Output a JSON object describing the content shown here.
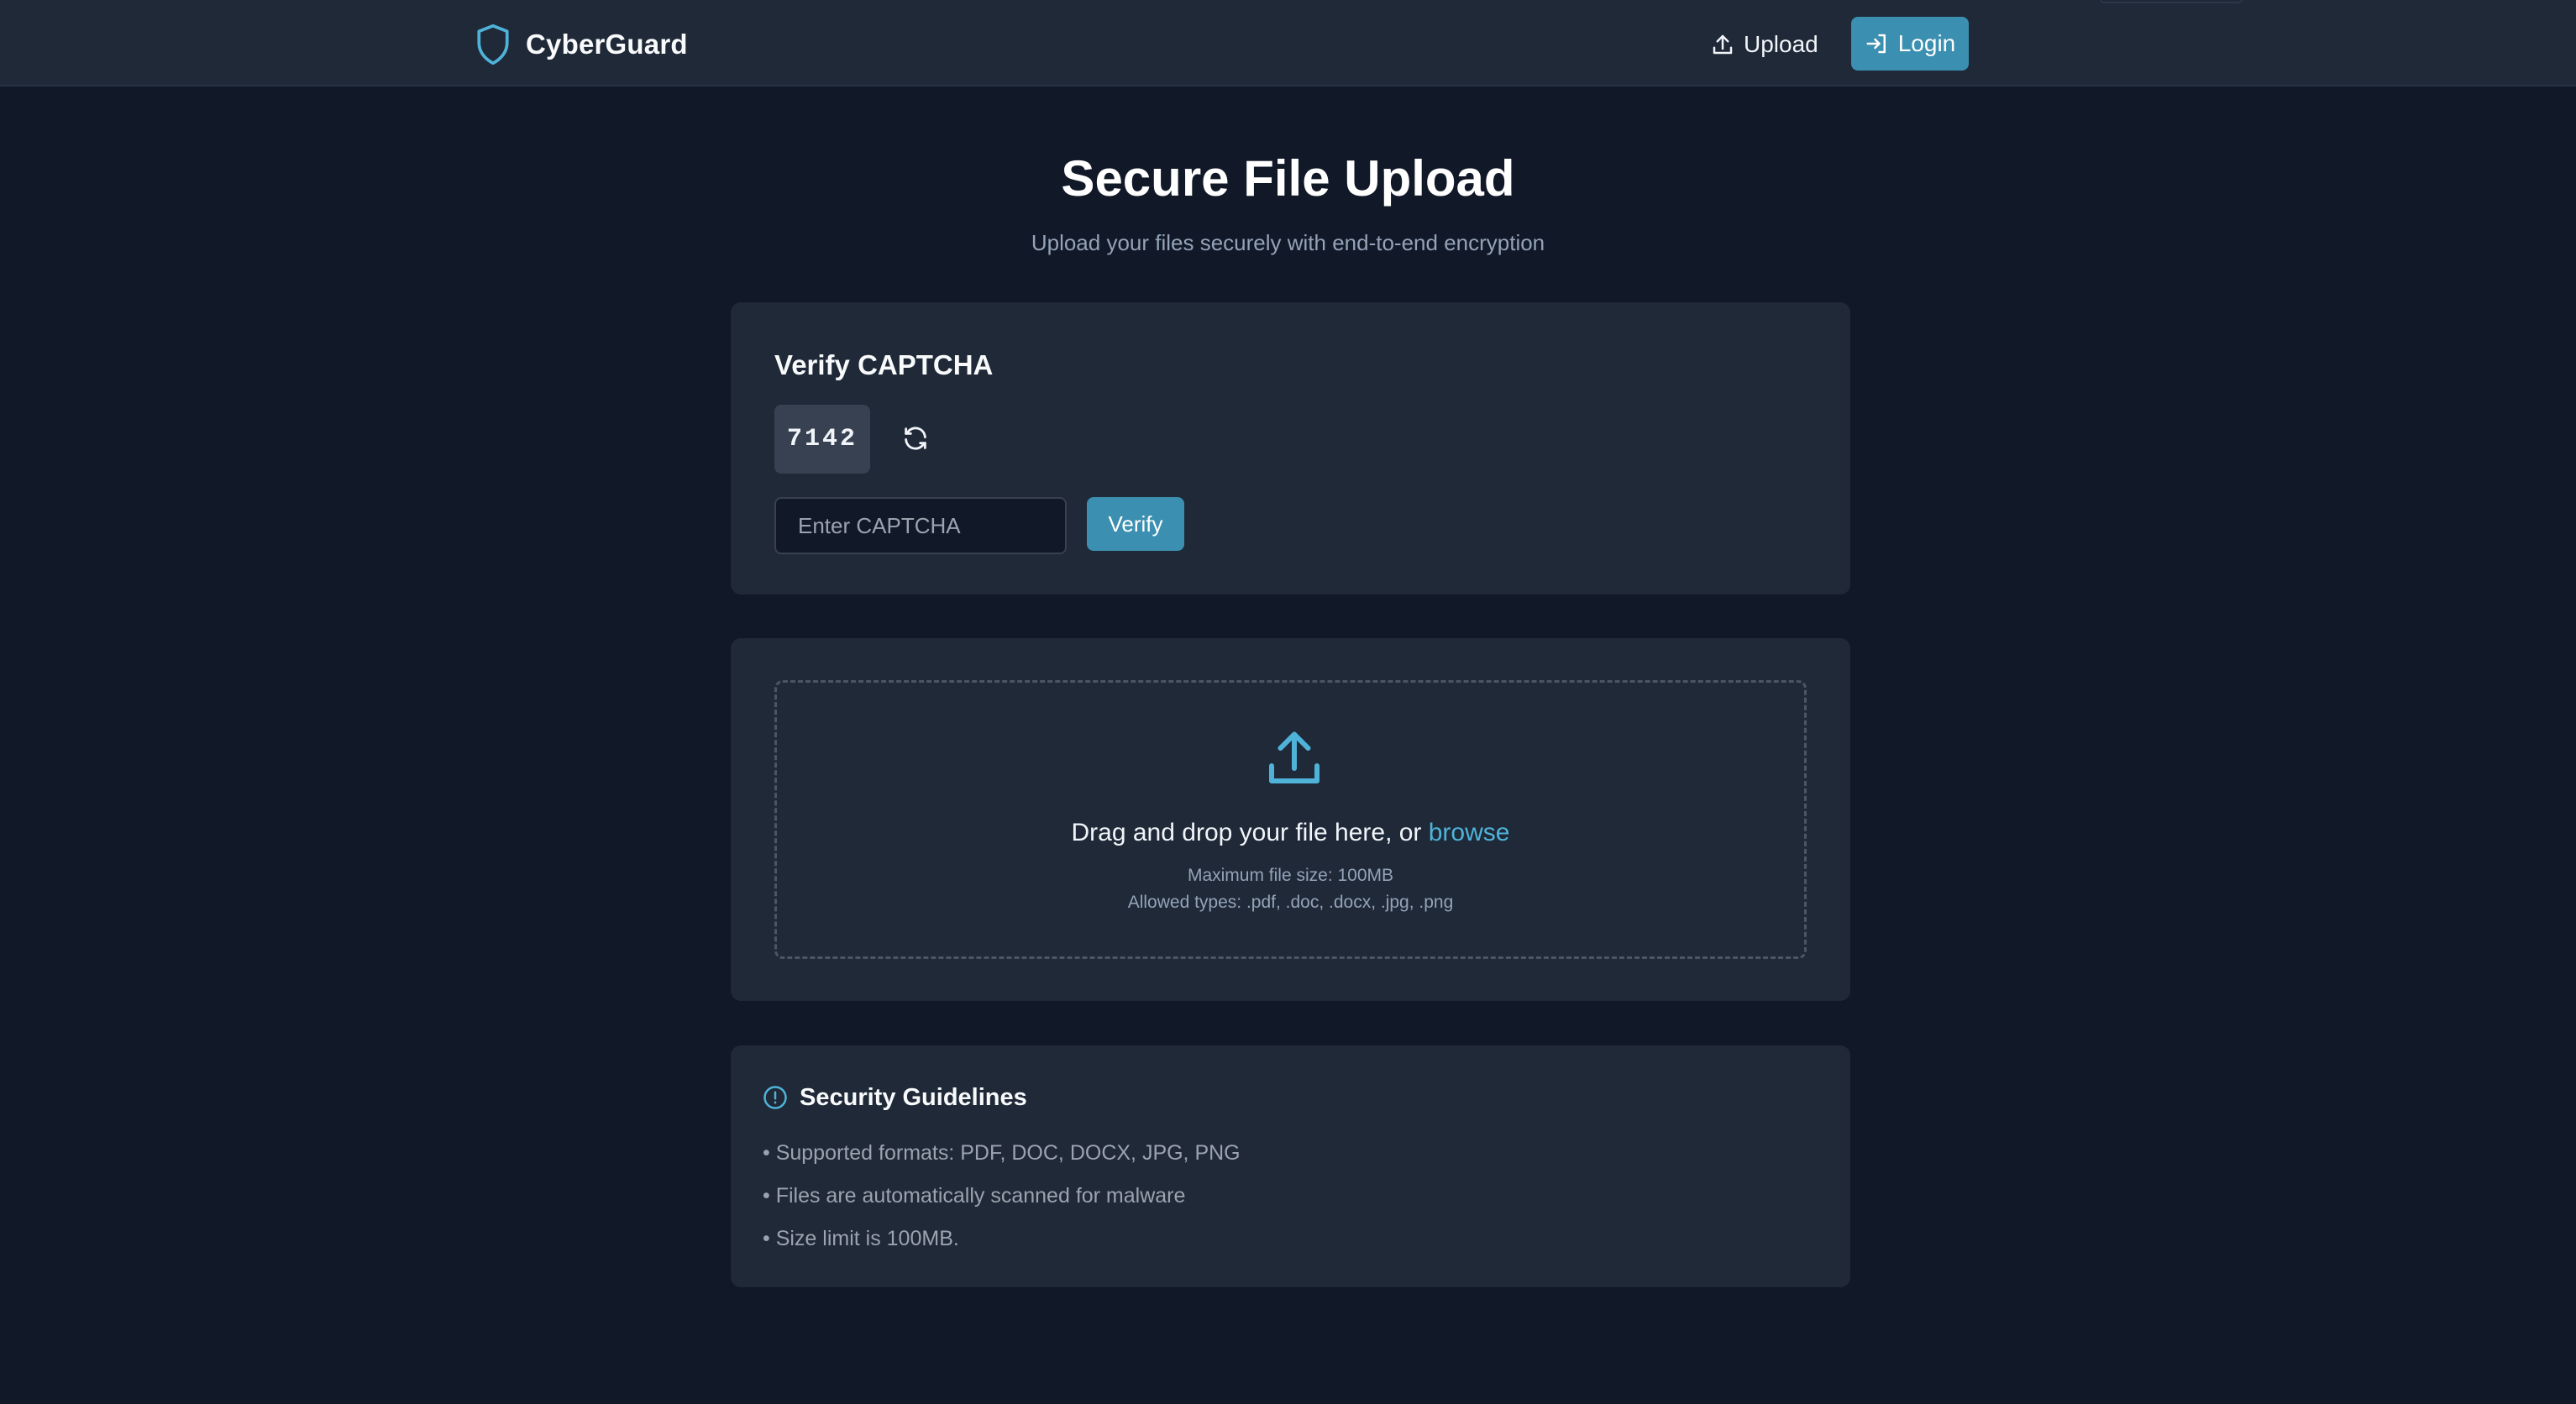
{
  "header": {
    "brand": "CyberGuard",
    "nav_upload": "Upload",
    "nav_login": "Login"
  },
  "hero": {
    "title": "Secure File Upload",
    "subtitle": "Upload your files securely with end-to-end encryption"
  },
  "captcha": {
    "title": "Verify CAPTCHA",
    "code": "7142",
    "input_placeholder": "Enter CAPTCHA",
    "verify_label": "Verify"
  },
  "dropzone": {
    "text_prefix": "Drag and drop your file here, or ",
    "browse_label": "browse",
    "max_size": "Maximum file size: 100MB",
    "allowed_types": "Allowed types: .pdf, .doc, .docx, .jpg, .png"
  },
  "guidelines": {
    "title": "Security Guidelines",
    "items": [
      "• Supported formats: PDF, DOC, DOCX, JPG, PNG",
      "• Files are automatically scanned for malware",
      "• Size limit is 100MB."
    ]
  },
  "colors": {
    "background": "#111827",
    "header_bg": "#1f2937",
    "card_bg": "#1f2937",
    "accent": "#3b8fb0",
    "link": "#4fb3d9",
    "muted_text": "#94a3b8"
  },
  "icons": {
    "brand": "shield-icon",
    "upload_nav": "upload-icon",
    "login": "login-icon",
    "refresh": "refresh-icon",
    "dropzone": "upload-tray-icon",
    "guidelines": "info-circle-icon"
  }
}
